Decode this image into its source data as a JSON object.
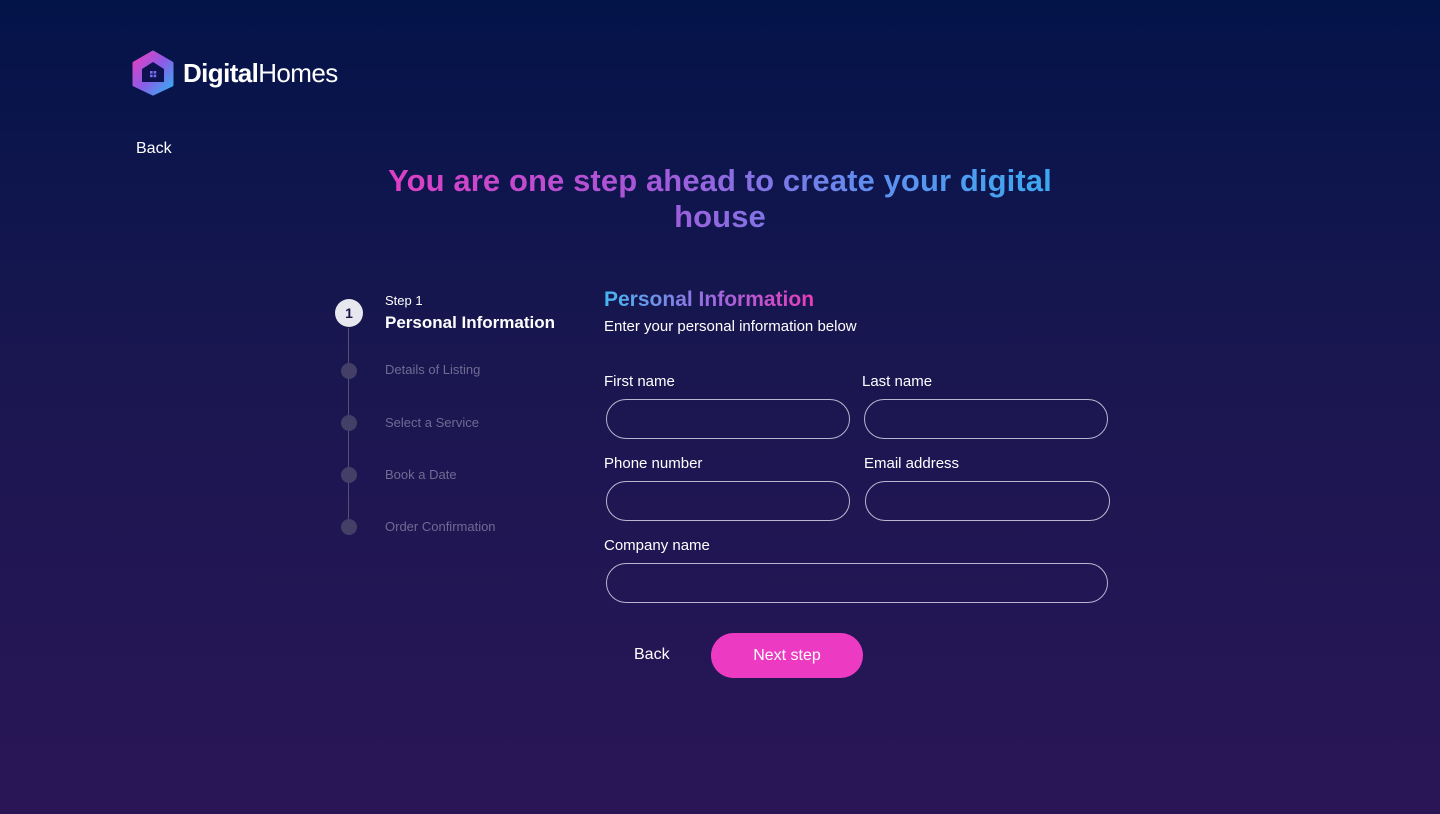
{
  "brand": {
    "name_bold": "Digital",
    "name_light": "Homes"
  },
  "nav": {
    "back_label": "Back"
  },
  "headline": "You are one step ahead to create your digital house",
  "steps": {
    "active_number": "1",
    "active_caption": "Step 1",
    "active_title": "Personal Information",
    "upcoming": [
      "Details of Listing",
      "Select a Service",
      "Book a Date",
      "Order Confirmation"
    ]
  },
  "form": {
    "title": "Personal Information",
    "subtitle": "Enter your personal information below",
    "fields": {
      "first_name": {
        "label": "First name",
        "value": ""
      },
      "last_name": {
        "label": "Last name",
        "value": ""
      },
      "phone": {
        "label": "Phone number",
        "value": ""
      },
      "email": {
        "label": "Email address",
        "value": ""
      },
      "company": {
        "label": "Company name",
        "value": ""
      }
    },
    "back_label": "Back",
    "next_label": "Next step"
  },
  "colors": {
    "accent_pink": "#ec3bc2",
    "accent_blue": "#33b0f2",
    "background_top": "#031449",
    "background_bottom": "#2a1657"
  }
}
